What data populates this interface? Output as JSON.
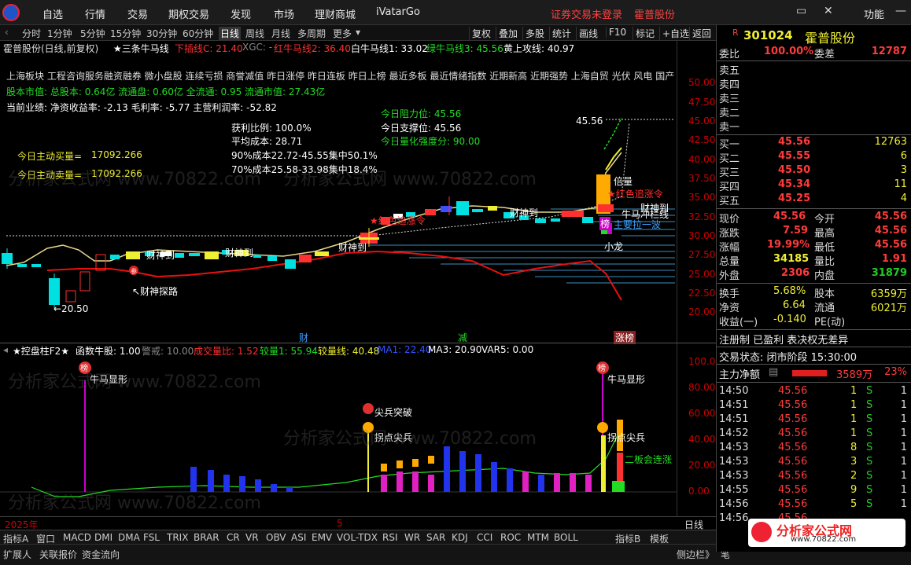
{
  "menubar": {
    "items": [
      "自选",
      "行情",
      "交易",
      "期权交易",
      "发现",
      "市场",
      "理财商城",
      "iVatarGo"
    ],
    "notice": "证券交易未登录",
    "stock_link": "霍普股份",
    "func": "功能"
  },
  "periods": {
    "items": [
      "分时",
      "1分钟",
      "5分钟",
      "15分钟",
      "30分钟",
      "60分钟",
      "日线",
      "周线",
      "月线",
      "多周期",
      "更多"
    ],
    "active": "日线"
  },
  "tools": [
    "复权",
    "叠加",
    "多股",
    "统计",
    "画线",
    "F10",
    "标记",
    "+自选",
    "返回"
  ],
  "chart_header": {
    "title": "霍普股份(日线,前复权)",
    "indicator": "★三条牛马线",
    "lines": [
      {
        "text": "下插线C: 21.40",
        "color": "#ff3030"
      },
      {
        "text": "XGC: -",
        "color": "#888888"
      },
      {
        "text": "红牛马线2: 36.40",
        "color": "#ff3030"
      },
      {
        "text": "白牛马线1: 33.02",
        "color": "#ffffff"
      },
      {
        "text": "绿牛马线3: 45.56",
        "color": "#22dd22"
      },
      {
        "text": "黄上攻线: 40.97",
        "color": "#ffffff"
      }
    ]
  },
  "info": {
    "concepts": "上海板块  工程咨询服务融资融券  微小盘股 连续亏损 商誉减值 昨日涨停 昨日连板 昨日上榜 最近多板 最近情绪指数 近期新高 近期强势  上海自贸 光伏 风电 国产",
    "capital": "股本市值: 总股本: 0.64亿 流通盘: 0.60亿 全流通: 0.95 流通市值: 27.43亿",
    "performance": "当前业绩:  净资收益率: -2.13 毛利率: -5.77 主营利润率: -52.82",
    "active_buy_label": "今日主动买量=",
    "active_buy": "17092.266",
    "active_sell_label": "今日主动卖量=",
    "active_sell": "17092.266",
    "profit_ratio": "获利比例: 100.0%",
    "avg_cost": "平均成本: 28.71",
    "cost90": "90%成本22.72-45.55集中50.1%",
    "cost70": "70%成本25.58-33.98集中18.4%",
    "resistance": "今日阻力位:  45.56",
    "support": "今日支撑位:  45.56",
    "strength": "今日量化强度分:  90.00"
  },
  "annotations": {
    "wealth_explore": "↖财神探路",
    "low_price": "←20.50",
    "caishen1": "财神到",
    "caishen2": "财神到",
    "caishen3": "财神到",
    "caishen4": "财神到",
    "caishen5": "财神到",
    "red_chase1": "★红色追涨令",
    "red_chase2": "★红色追涨令",
    "double_vol": "倍量",
    "bull_break": "牛马冲栏线",
    "strong_wave": "主要拉一波",
    "small_dragon": "小龙",
    "high_price": "45.56",
    "bang": "榜",
    "can": "参",
    "marker_cai": "财",
    "marker_jian": "减",
    "marker_zhangbang": "涨榜"
  },
  "main_axis": [
    "50.00",
    "47.50",
    "45.00",
    "42.50",
    "40.00",
    "37.50",
    "35.00",
    "32.50",
    "30.00",
    "27.50",
    "25.00",
    "22.50",
    "20.00"
  ],
  "sub_header": {
    "title": "★控盘柱F2★",
    "items": [
      {
        "text": "函数牛股: 1.00",
        "color": "#ffffff"
      },
      {
        "text": "警戒: 10.00",
        "color": "#888888"
      },
      {
        "text": "成交量比: 1.52",
        "color": "#ff3030"
      },
      {
        "text": "较量1: 55.94",
        "color": "#22dd22"
      },
      {
        "text": "较量线: 40.48",
        "color": "#ee3"
      },
      {
        "text": "MA1: 22.40",
        "color": "#3355ff"
      },
      {
        "text": "MA3: 20.90",
        "color": "#ffffff"
      },
      {
        "text": "VAR5: 0.00",
        "color": "#ffffff"
      }
    ]
  },
  "sub_annot": {
    "bull_show1": "牛马显形",
    "bull_show2": "牛马显形",
    "breakout": "尖兵突破",
    "turn1": "拐点尖兵",
    "turn2": "拐点尖兵",
    "board_rise": "二板会连涨"
  },
  "sub_axis": [
    "100.00",
    "80.00",
    "60.00",
    "40.00",
    "20.00",
    "0.00"
  ],
  "time_axis": {
    "year": "2025年",
    "month": "5",
    "mode": "日线"
  },
  "bottom_tabs": [
    "指标A",
    "窗口",
    "MACD",
    "DMI",
    "DMA",
    "FSL",
    "TRIX",
    "BRAR",
    "CR",
    "VR",
    "OBV",
    "ASI",
    "EMV",
    "VOL-TDX",
    "RSI",
    "WR",
    "SAR",
    "KDJ",
    "CCI",
    "ROC",
    "MTM",
    "BOLL",
    "指标B",
    "模板"
  ],
  "bottom_tabs2": [
    "扩展人",
    "关联报价",
    "资金流向"
  ],
  "right_panel": {
    "code_prefix": "R",
    "code": "301024",
    "name": "霍普股份",
    "weibi_label": "委比",
    "weibi": "100.00%",
    "weicha_label": "委差",
    "weicha": "12787",
    "sells": [
      {
        "label": "卖五",
        "price": "",
        "vol": ""
      },
      {
        "label": "卖四",
        "price": "",
        "vol": ""
      },
      {
        "label": "卖三",
        "price": "",
        "vol": ""
      },
      {
        "label": "卖二",
        "price": "",
        "vol": ""
      },
      {
        "label": "卖一",
        "price": "",
        "vol": ""
      }
    ],
    "buys": [
      {
        "label": "买一",
        "price": "45.56",
        "vol": "12763"
      },
      {
        "label": "买二",
        "price": "45.55",
        "vol": "6"
      },
      {
        "label": "买三",
        "price": "45.50",
        "vol": "3"
      },
      {
        "label": "买四",
        "price": "45.34",
        "vol": "11"
      },
      {
        "label": "买五",
        "price": "45.25",
        "vol": "4"
      }
    ],
    "quote": [
      {
        "l1": "现价",
        "v1": "45.56",
        "l2": "今开",
        "v2": "45.56"
      },
      {
        "l1": "涨跌",
        "v1": "7.59",
        "l2": "最高",
        "v2": "45.56"
      },
      {
        "l1": "涨幅",
        "v1": "19.99%",
        "l2": "最低",
        "v2": "45.56"
      },
      {
        "l1": "总量",
        "v1": "34185",
        "l2": "量比",
        "v2": "1.91"
      },
      {
        "l1": "外盘",
        "v1": "2306",
        "l2": "内盘",
        "v2": "31879"
      }
    ],
    "stats": [
      {
        "l1": "换手",
        "v1": "5.68%",
        "l2": "股本",
        "v2": "6359万"
      },
      {
        "l1": "净资",
        "v1": "6.64",
        "l2": "流通",
        "v2": "6021万"
      },
      {
        "l1": "收益(一)",
        "v1": "-0.140",
        "l2": "PE(动)",
        "v2": ""
      }
    ],
    "reg": "注册制 已盈利 表决权无差异",
    "trade_state": "交易状态: 闭市阶段 15:30:00",
    "net_label": "主力净额",
    "net_value": "3589万",
    "net_pct": "23%",
    "ticks": [
      {
        "time": "14:50",
        "price": "45.56",
        "vol": "1",
        "side": "S",
        "n": "1"
      },
      {
        "time": "14:51",
        "price": "45.56",
        "vol": "1",
        "side": "S",
        "n": "1"
      },
      {
        "time": "14:51",
        "price": "45.56",
        "vol": "1",
        "side": "S",
        "n": "1"
      },
      {
        "time": "14:52",
        "price": "45.56",
        "vol": "1",
        "side": "S",
        "n": "1"
      },
      {
        "time": "14:53",
        "price": "45.56",
        "vol": "8",
        "side": "S",
        "n": "1"
      },
      {
        "time": "14:53",
        "price": "45.56",
        "vol": "3",
        "side": "S",
        "n": "1"
      },
      {
        "time": "14:53",
        "price": "45.56",
        "vol": "2",
        "side": "S",
        "n": "1"
      },
      {
        "time": "14:55",
        "price": "45.56",
        "vol": "9",
        "side": "S",
        "n": "1"
      },
      {
        "time": "14:56",
        "price": "45.56",
        "vol": "5",
        "side": "S",
        "n": "1"
      },
      {
        "time": "14:56",
        "price": "45.56",
        "vol": "",
        "side": "",
        "n": ""
      }
    ],
    "side_label": "侧边栏》",
    "pen": "笔"
  },
  "watermark": "分析家公式网 www.70822.com",
  "brand": {
    "name": "分析家公式网",
    "url": "www.70822.com"
  }
}
